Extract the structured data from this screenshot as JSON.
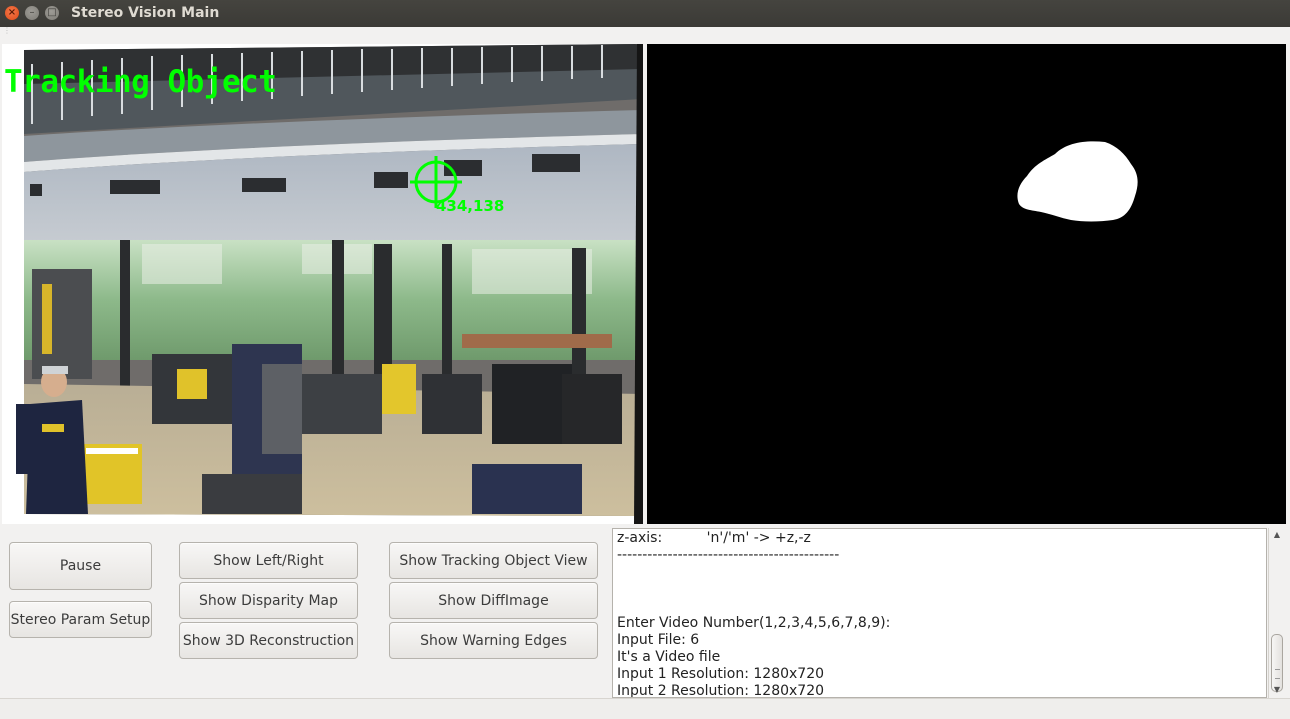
{
  "window": {
    "title": "Stereo Vision Main",
    "close_glyph": "×",
    "minimize_glyph": "–",
    "maximize_glyph": "□"
  },
  "left_view": {
    "overlay_label": "Tracking Object",
    "target_coords": "434,138",
    "overlay_color": "#00ff00"
  },
  "right_view": {
    "background_color": "#000000",
    "blob_color": "#ffffff"
  },
  "buttons": {
    "pause": "Pause",
    "stereo_param_setup": "Stereo Param Setup",
    "show_left_right": "Show Left/Right",
    "show_disparity_map": "Show Disparity Map",
    "show_3d_reconstruction": "Show 3D Reconstruction",
    "show_tracking_object_view": "Show Tracking Object View",
    "show_diffimage": "Show DiffImage",
    "show_warning_edges": "Show Warning Edges"
  },
  "console": {
    "lines": [
      "z-axis:          'n'/'m' -> +z,-z",
      "--------------------------------------------",
      "",
      "",
      "",
      "Enter Video Number(1,2,3,4,5,6,7,8,9):",
      "Input File: 6",
      "It's a Video file",
      "Input 1 Resolution: 1280x720",
      "Input 2 Resolution: 1280x720"
    ]
  },
  "icons": {
    "scroll_up": "up-arrow-icon",
    "scroll_down": "down-arrow-icon"
  }
}
